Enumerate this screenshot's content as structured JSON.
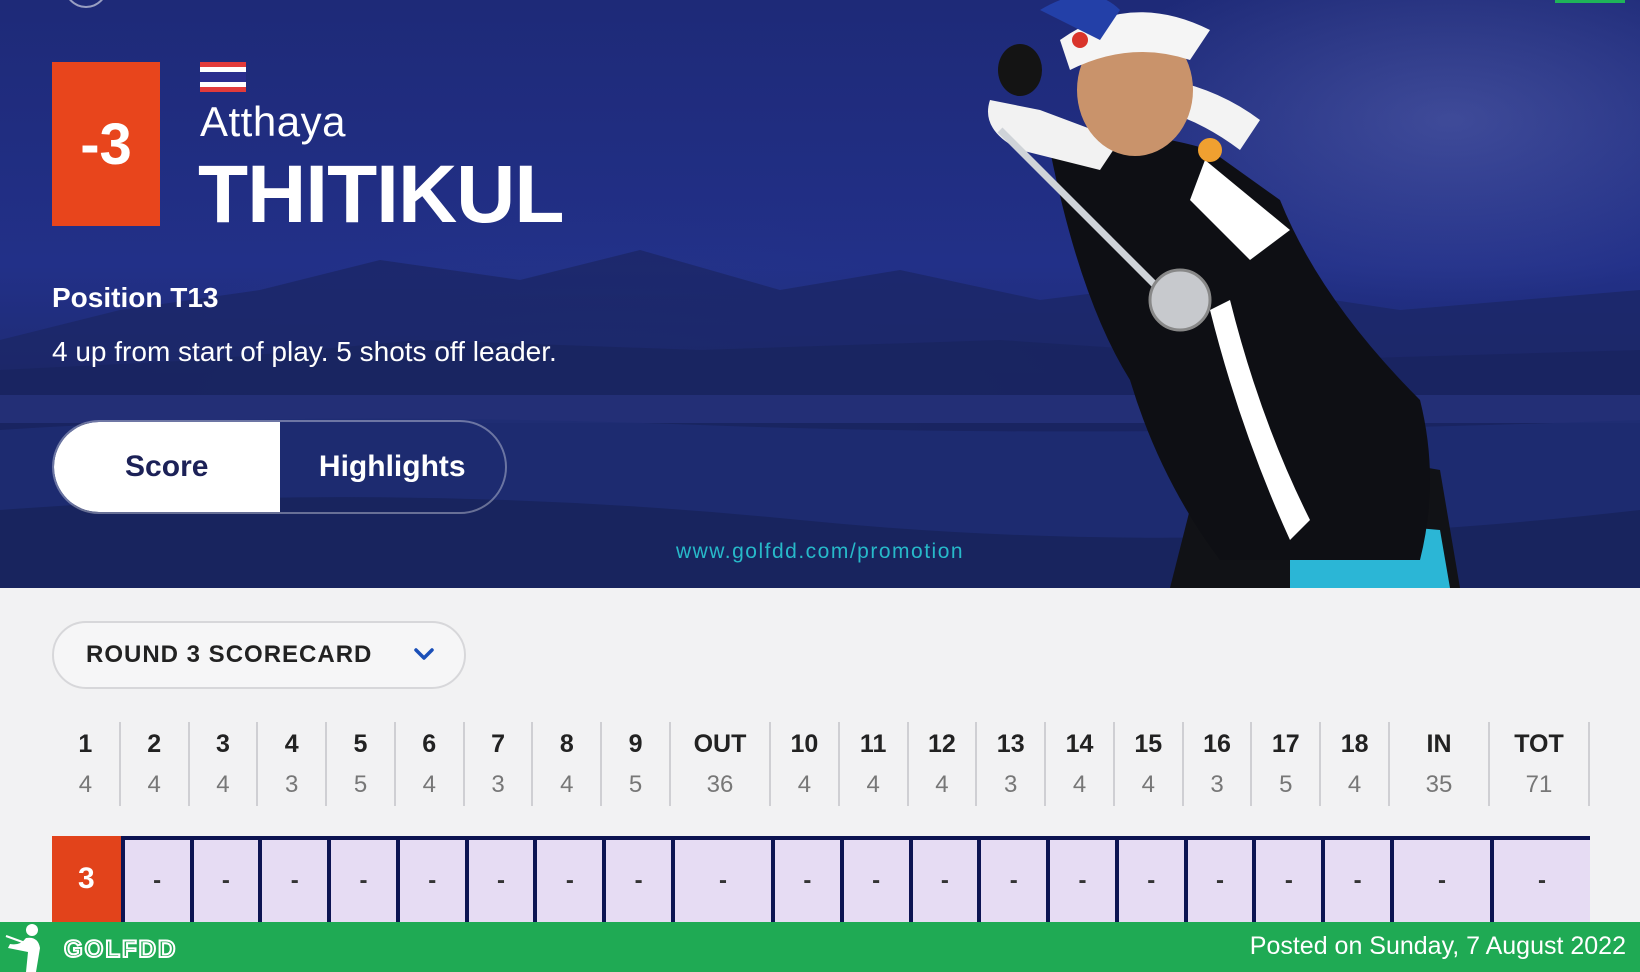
{
  "player": {
    "score": "-3",
    "first_name": "Atthaya",
    "last_name": "THITIKUL",
    "position": "Position T13",
    "summary": "4 up from start of play. 5 shots off leader."
  },
  "tabs": {
    "score": "Score",
    "highlights": "Highlights",
    "active": "Score"
  },
  "watermark": "www.golfdd.com/promotion",
  "scorecard": {
    "dropdown_label": "ROUND 3 SCORECARD",
    "columns": [
      {
        "hole": "1",
        "par": "4",
        "score": "3"
      },
      {
        "hole": "2",
        "par": "4",
        "score": "-"
      },
      {
        "hole": "3",
        "par": "4",
        "score": "-"
      },
      {
        "hole": "4",
        "par": "3",
        "score": "-"
      },
      {
        "hole": "5",
        "par": "5",
        "score": "-"
      },
      {
        "hole": "6",
        "par": "4",
        "score": "-"
      },
      {
        "hole": "7",
        "par": "3",
        "score": "-"
      },
      {
        "hole": "8",
        "par": "4",
        "score": "-"
      },
      {
        "hole": "9",
        "par": "5",
        "score": "-"
      },
      {
        "hole": "OUT",
        "par": "36",
        "score": "-"
      },
      {
        "hole": "10",
        "par": "4",
        "score": "-"
      },
      {
        "hole": "11",
        "par": "4",
        "score": "-"
      },
      {
        "hole": "12",
        "par": "4",
        "score": "-"
      },
      {
        "hole": "13",
        "par": "3",
        "score": "-"
      },
      {
        "hole": "14",
        "par": "4",
        "score": "-"
      },
      {
        "hole": "15",
        "par": "4",
        "score": "-"
      },
      {
        "hole": "16",
        "par": "3",
        "score": "-"
      },
      {
        "hole": "17",
        "par": "5",
        "score": "-"
      },
      {
        "hole": "18",
        "par": "4",
        "score": "-"
      },
      {
        "hole": "IN",
        "par": "35",
        "score": "-"
      },
      {
        "hole": "TOT",
        "par": "71",
        "score": "-"
      }
    ]
  },
  "footer": {
    "brand": "GOLFDD",
    "posted": "Posted on Sunday, 7 August 2022"
  },
  "colors": {
    "hero_bg": "#1e2a78",
    "score_box": "#e8451c",
    "score_cell": "#e6dcf3",
    "footer_green": "#1faa54",
    "watermark": "#27b9c9"
  },
  "icons": [
    "thailand-flag-icon",
    "chevron-down-icon",
    "golfer-logo-icon"
  ]
}
